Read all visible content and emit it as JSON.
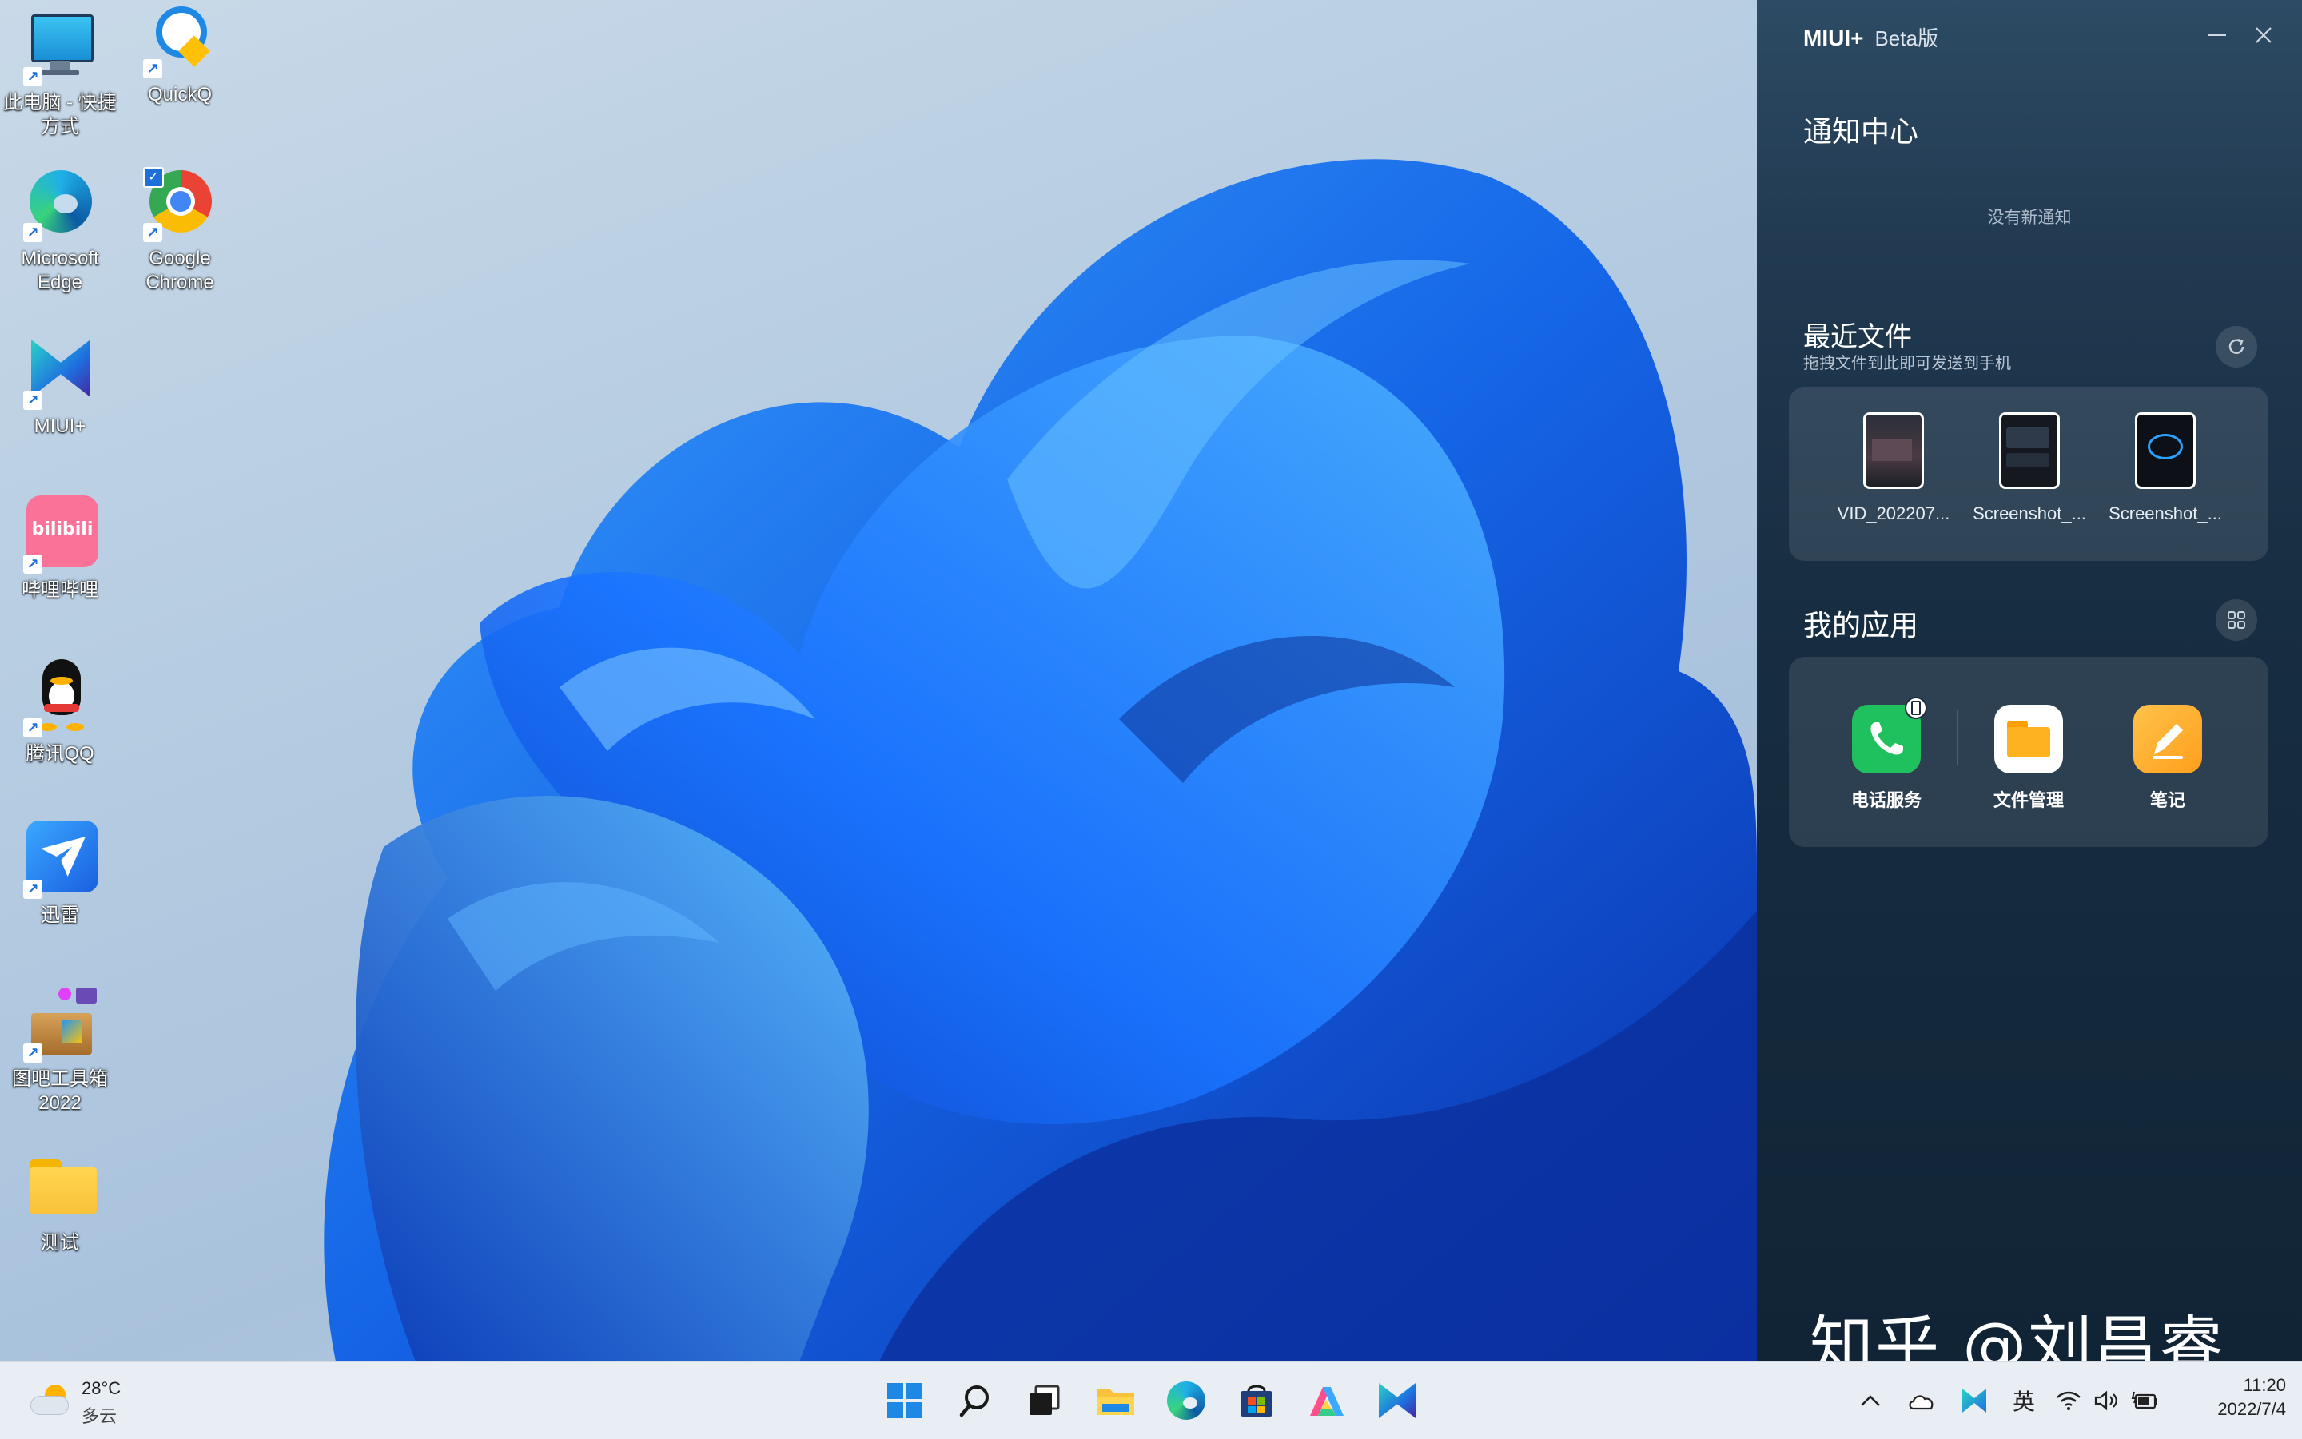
{
  "desktop": {
    "icons": [
      {
        "label": "此电脑 - 快捷方式",
        "icon": "this-pc-icon"
      },
      {
        "label": "QuickQ",
        "icon": "quickq-icon"
      },
      {
        "label": "Microsoft Edge",
        "icon": "edge-icon"
      },
      {
        "label": "Google Chrome",
        "icon": "chrome-icon"
      },
      {
        "label": "MIUI+",
        "icon": "miui-plus-icon"
      },
      {
        "label": "哔哩哔哩",
        "icon": "bilibili-icon"
      },
      {
        "label": "腾讯QQ",
        "icon": "qq-icon"
      },
      {
        "label": "迅雷",
        "icon": "xunlei-icon"
      },
      {
        "label": "图吧工具箱2022",
        "icon": "tuba-toolbox-icon"
      },
      {
        "label": "测试",
        "icon": "folder-icon"
      }
    ],
    "bilibili_text": "bilibili",
    "watermark": "知乎 @刘昌睿"
  },
  "miui_panel": {
    "app_name": "MIUI+",
    "version": "Beta版",
    "notification": {
      "title": "通知中心",
      "empty_text": "没有新通知"
    },
    "recent_files": {
      "title": "最近文件",
      "subtitle": "拖拽文件到此即可发送到手机",
      "files": [
        "VID_202207...",
        "Screenshot_...",
        "Screenshot_..."
      ]
    },
    "my_apps": {
      "title": "我的应用",
      "apps": [
        {
          "name": "电话服务",
          "icon": "phone-icon",
          "color": "#1fc15f"
        },
        {
          "name": "文件管理",
          "icon": "file-manager-icon",
          "color": "#ffb21f"
        },
        {
          "name": "笔记",
          "icon": "notes-icon",
          "color": "#ffa726"
        }
      ]
    }
  },
  "taskbar": {
    "weather": {
      "temp": "28°C",
      "condition": "多云",
      "icon": "partly-cloudy-icon"
    },
    "apps": [
      "start-icon",
      "search-icon",
      "task-view-icon",
      "file-explorer-icon",
      "edge-icon",
      "microsoft-store-icon",
      "copilot-colorful-icon",
      "miui-plus-icon"
    ],
    "tray": {
      "ime": "英",
      "time": "11:20",
      "date": "2022/7/4"
    }
  },
  "colors": {
    "accent_blue": "#1e6fd9",
    "panel_bg": "#172d41",
    "taskbar_bg": "#e9eef5"
  }
}
